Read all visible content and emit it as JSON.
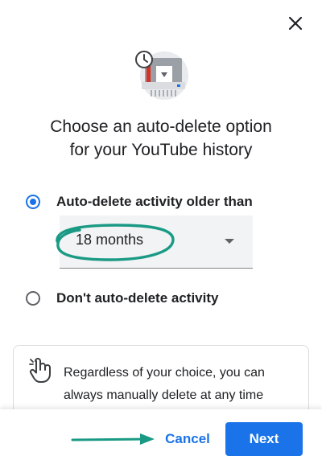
{
  "dialog": {
    "title_line1": "Choose an auto-delete option",
    "title_line2": "for your YouTube history",
    "options": [
      {
        "label": "Auto-delete activity older than",
        "selected": true
      },
      {
        "label": "Don't auto-delete activity",
        "selected": false
      }
    ],
    "period_select": {
      "value": "18 months"
    },
    "info_text": "Regardless of your choice, you can always manually delete at any time",
    "buttons": {
      "cancel": "Cancel",
      "next": "Next"
    }
  },
  "icons": {
    "close": "close-icon",
    "hero": "history-shredder-icon",
    "dropdown": "chevron-down-icon",
    "info": "touch-hand-icon"
  },
  "colors": {
    "accent": "#1a73e8",
    "annotation": "#1a9a84",
    "text": "#202124",
    "select_bg": "#f1f3f4"
  }
}
